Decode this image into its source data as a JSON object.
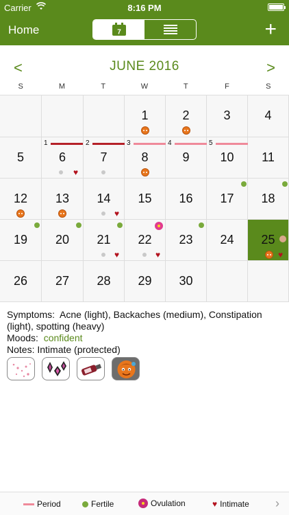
{
  "status_bar": {
    "carrier": "Carrier",
    "time": "8:16 PM"
  },
  "nav": {
    "home_label": "Home",
    "calendar_tab_icon": "calendar-icon",
    "calendar_day": "7",
    "list_tab_icon": "list-icon",
    "add_icon": "plus-icon",
    "add_label": "+"
  },
  "calendar": {
    "month_title": "JUNE 2016",
    "prev_label": "<",
    "next_label": ">",
    "weekdays": [
      "S",
      "M",
      "T",
      "W",
      "T",
      "F",
      "S"
    ],
    "days": [
      "1",
      "2",
      "3",
      "4",
      "5",
      "6",
      "7",
      "8",
      "9",
      "10",
      "11",
      "12",
      "13",
      "14",
      "15",
      "16",
      "17",
      "18",
      "19",
      "20",
      "21",
      "22",
      "23",
      "24",
      "25",
      "26",
      "27",
      "28",
      "29",
      "30"
    ],
    "cycle_days": [
      "1",
      "2",
      "3",
      "4",
      "5"
    ],
    "selected_day": "25"
  },
  "details": {
    "symptoms_label": "Symptoms:",
    "symptoms_value": "Acne (light), Backaches (medium), Constipation (light), spotting (heavy)",
    "moods_label": "Moods:",
    "moods_value": "confident",
    "notes_label": "Notes:",
    "notes_value": "Intimate (protected)",
    "stickers": [
      "sparkles-sticker",
      "diamonds-sticker",
      "bottle-sticker",
      "face-sticker"
    ]
  },
  "legend": {
    "period": "Period",
    "fertile": "Fertile",
    "ovulation": "Ovulation",
    "intimate": "Intimate"
  },
  "colors": {
    "brand": "#5a8a1c",
    "period_dark": "#b52128",
    "period_light": "#ef8a9a",
    "fertile": "#7aaa3c",
    "heart": "#b3121e"
  }
}
